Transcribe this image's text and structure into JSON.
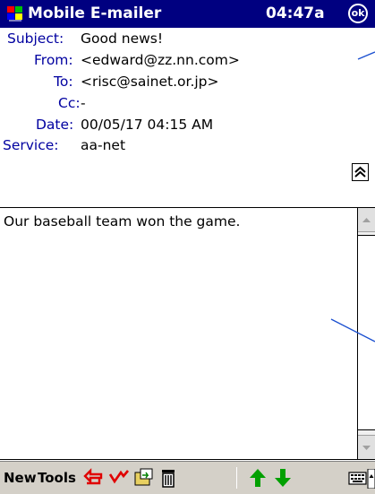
{
  "titlebar": {
    "app_title": "Mobile E-mailer",
    "time": "04:47a",
    "ok_label": "ok",
    "bg_color": "#000080"
  },
  "headers": {
    "subject": {
      "label": "Subject:",
      "value": "Good news!"
    },
    "from": {
      "label": "From:",
      "value": "<edward@zz.nn.com>"
    },
    "to": {
      "label": "To:",
      "value": "<risc@sainet.or.jp>"
    },
    "cc": {
      "label": "Cc:",
      "value": "-"
    },
    "date": {
      "label": "Date:",
      "value": "00/05/17 04:15 AM"
    },
    "service": {
      "label": "Service:",
      "value": "aa-net"
    },
    "label_color": "#0000a0"
  },
  "message": {
    "body": "Our baseball team won the game."
  },
  "menubar": {
    "new_label": "New",
    "tools_label": "Tools",
    "icons": [
      "reply-icon",
      "reply-all-icon",
      "move-folder-icon",
      "delete-icon",
      "previous-message-icon",
      "next-message-icon",
      "keyboard-icon"
    ]
  }
}
